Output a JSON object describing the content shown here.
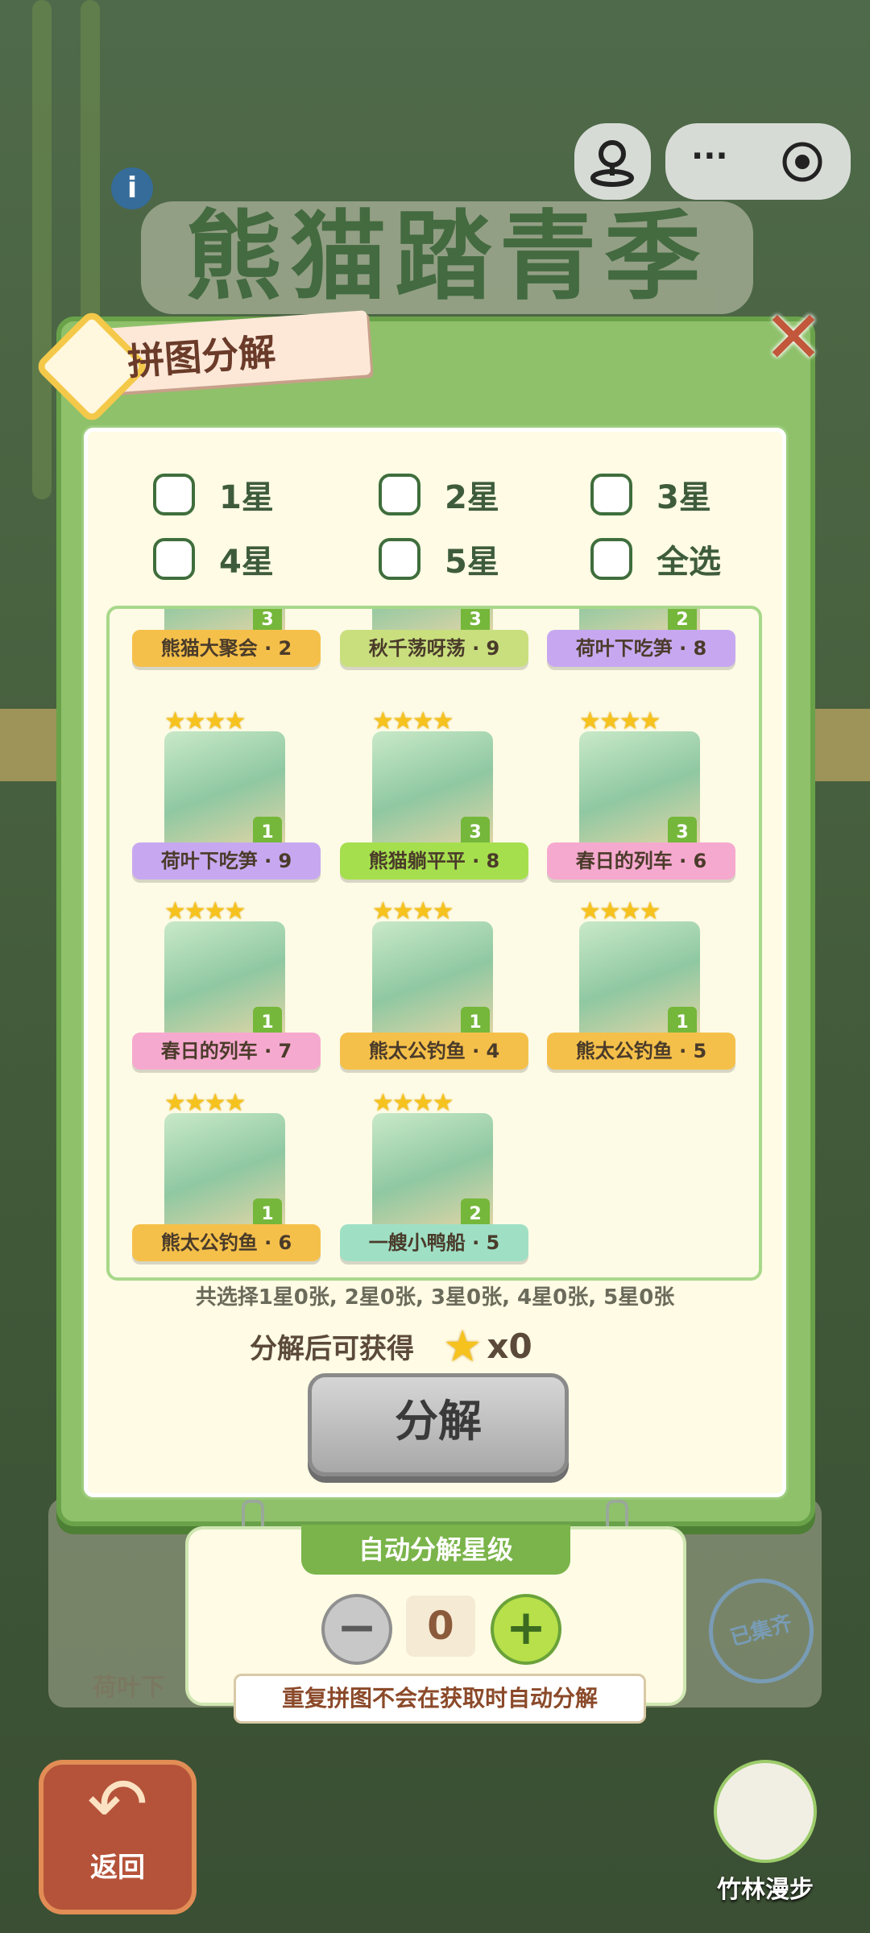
{
  "app": {
    "bg_title": "熊猫踏青季"
  },
  "dialog": {
    "title": "拼图分解",
    "close_label": "✕",
    "filters": [
      {
        "label": "1星",
        "checked": false
      },
      {
        "label": "2星",
        "checked": false
      },
      {
        "label": "3星",
        "checked": false
      },
      {
        "label": "4星",
        "checked": false
      },
      {
        "label": "5星",
        "checked": false
      },
      {
        "label": "全选",
        "checked": false
      }
    ],
    "pieces": [
      {
        "name": "熊猫大聚会 · 2",
        "count": "3",
        "stars": "",
        "color": "orange"
      },
      {
        "name": "秋千荡呀荡 · 9",
        "count": "3",
        "stars": "",
        "color": "yellowgreen"
      },
      {
        "name": "荷叶下吃笋 · 8",
        "count": "2",
        "stars": "",
        "color": "purple"
      },
      {
        "name": "荷叶下吃笋 · 9",
        "count": "1",
        "stars": "★★★★",
        "color": "purple"
      },
      {
        "name": "熊猫躺平平 · 8",
        "count": "3",
        "stars": "★★★★",
        "color": "lime"
      },
      {
        "name": "春日的列车 · 6",
        "count": "3",
        "stars": "★★★★",
        "color": "pink"
      },
      {
        "name": "春日的列车 · 7",
        "count": "1",
        "stars": "★★★★",
        "color": "pink"
      },
      {
        "name": "熊太公钓鱼 · 4",
        "count": "1",
        "stars": "★★★★",
        "color": "orange"
      },
      {
        "name": "熊太公钓鱼 · 5",
        "count": "1",
        "stars": "★★★★",
        "color": "orange"
      },
      {
        "name": "熊太公钓鱼 · 6",
        "count": "1",
        "stars": "★★★★",
        "color": "orange"
      },
      {
        "name": "一艘小鸭船 · 5",
        "count": "2",
        "stars": "★★★★",
        "color": "mint"
      }
    ],
    "summary": "共选择1星0张, 2星0张, 3星0张, 4星0张, 5星0张",
    "reward_label": "分解后可获得",
    "reward_icon": "star-icon",
    "reward_count": "x0",
    "decompose_label": "分解"
  },
  "auto_panel": {
    "header": "自动分解星级",
    "level": "0",
    "minus_label": "−",
    "plus_label": "+",
    "note": "重复拼图不会在获取时自动分解"
  },
  "background": {
    "card_text": "荷叶下",
    "stamp_text": "已集齐"
  },
  "nav": {
    "back_label": "返回",
    "stroll_label": "竹林漫步"
  },
  "system": {
    "more_label": "···"
  }
}
